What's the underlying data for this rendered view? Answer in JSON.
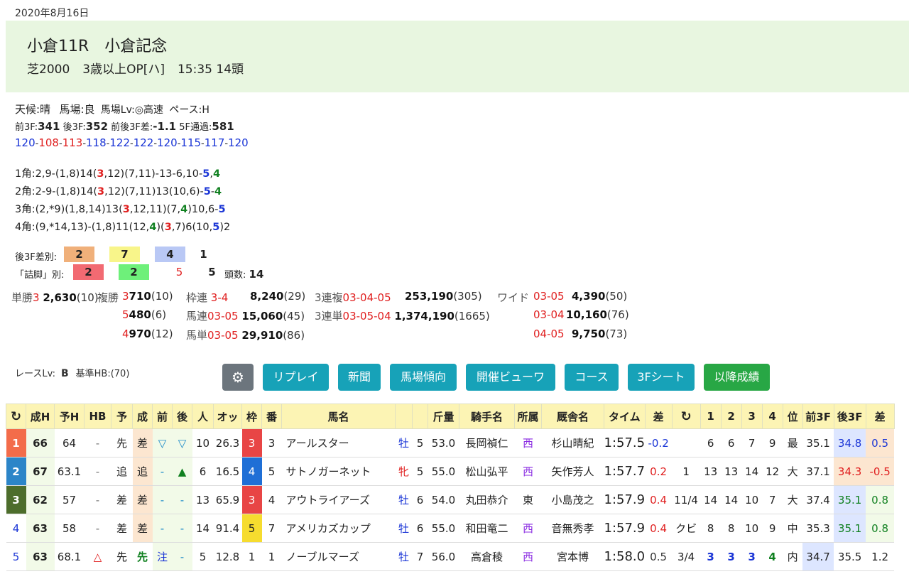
{
  "date": "2020年8月16日",
  "race": {
    "name1": "小倉11R",
    "name2": "小倉記念",
    "cond1": "芝2000",
    "cond2": "3歳以上OP[ハ]",
    "cond3": "15:35 14頭"
  },
  "conditions": {
    "weather": "天候:晴",
    "track": "馬場:良",
    "tracklv": "馬場Lv:◎高速",
    "pace": "ペース:H"
  },
  "f3": {
    "front_lbl": "前3F:",
    "front": "341",
    "back_lbl": "後3F:",
    "back": "352",
    "diff_lbl": "前後3F差:",
    "diff": "-1.1",
    "f5_lbl": "5F通過:",
    "f5": "581"
  },
  "laps": [
    "120",
    "108",
    "113",
    "118",
    "122",
    "122",
    "120",
    "115",
    "117",
    "120"
  ],
  "corners": {
    "c1": "1角:2,9-(1,8)14(<3>,12)(7,11)-13-6,10-[5],{4}",
    "c2": "2角:2-9-(1,8)14(<3>,12)(7,11)13(10,6)-[5]-{4}",
    "c3": "3角:(2,*9)(1,8,14)13(<3>,12,11)(7,{4})10,6-[5]",
    "c4": "4角:(9,*14,13)-(1,8)11(12,{4})(<3>,7)6(10,[5])2"
  },
  "diff3f": {
    "label": "後3F差別:",
    "v1": "2",
    "v2": "7",
    "v3": "4",
    "v4": "1"
  },
  "tsume": {
    "label": "「詰脚」別:",
    "v1": "2",
    "v2": "2",
    "v3": "5",
    "v4": "5",
    "count_lbl": "頭数:",
    "count": "14"
  },
  "payouts": {
    "tan_lbl": "単勝",
    "tan_num": "3",
    "tan_val": "2,630",
    "tan_pop": "(10)",
    "fuku_lbl": "複勝",
    "fuku": [
      {
        "n": "3",
        "v": "710",
        "p": "(10)"
      },
      {
        "n": "5",
        "v": "480",
        "p": "(6)"
      },
      {
        "n": "4",
        "v": "970",
        "p": "(12)"
      }
    ],
    "wakuren_lbl": "枠連",
    "wakuren_num": "3-4",
    "wakuren_val": "8,240",
    "wakuren_pop": "(29)",
    "umaren_lbl": "馬連",
    "umaren_num": "03-05",
    "umaren_val": "15,060",
    "umaren_pop": "(45)",
    "umatan_lbl": "馬単",
    "umatan_num": "03-05",
    "umatan_val": "29,910",
    "umatan_pop": "(86)",
    "sanpuku_lbl": "3連複",
    "sanpuku_num": "03-04-05",
    "sanpuku_val": "253,190",
    "sanpuku_pop": "(305)",
    "santan_lbl": "3連単",
    "santan_num": "03-05-04",
    "santan_val": "1,374,190",
    "santan_pop": "(1665)",
    "wide_lbl": "ワイド",
    "wide": [
      {
        "n": "03-05",
        "v": "4,390",
        "p": "(50)"
      },
      {
        "n": "03-04",
        "v": "10,160",
        "p": "(76)"
      },
      {
        "n": "04-05",
        "v": "9,750",
        "p": "(73)"
      }
    ]
  },
  "racelv": {
    "label": "レースLv:",
    "value": "B",
    "hb": "基準HB:(70)"
  },
  "buttons": {
    "settings": "⚙",
    "replay": "リプレイ",
    "news": "新聞",
    "trend": "馬場傾向",
    "viewer": "開催ビューワ",
    "course": "コース",
    "sheet": "3Fシート",
    "later": "以降成績"
  },
  "table": {
    "headers": [
      "↻",
      "成H",
      "予H",
      "HB",
      "予",
      "成",
      "前",
      "後",
      "人",
      "オッ",
      "枠",
      "番",
      "馬名",
      "",
      "",
      "斤量",
      "騎手名",
      "所属",
      "厩舎名",
      "タイム",
      "差",
      "↻",
      "1",
      "2",
      "3",
      "4",
      "位",
      "前3F",
      "後3F",
      "差"
    ],
    "rows": [
      [
        "1",
        "66",
        "64",
        "-",
        "先",
        "差",
        "▽",
        "▽",
        "10",
        "26.3",
        "3",
        "3",
        "アールスター",
        "牡",
        "5",
        "53.0",
        "長岡禎仁",
        "西",
        "杉山晴紀",
        "1:57.5",
        "-0.2",
        "",
        "6",
        "6",
        "7",
        "9",
        "最",
        "35.1",
        "34.8",
        "0.5"
      ],
      [
        "2",
        "67",
        "63.1",
        "-",
        "追",
        "追",
        "-",
        "▲",
        "6",
        "16.5",
        "4",
        "5",
        "サトノガーネット",
        "牝",
        "5",
        "55.0",
        "松山弘平",
        "西",
        "矢作芳人",
        "1:57.7",
        "0.2",
        "1",
        "13",
        "13",
        "14",
        "12",
        "大",
        "37.1",
        "34.3",
        "-0.5"
      ],
      [
        "3",
        "62",
        "57",
        "-",
        "差",
        "差",
        "-",
        "-",
        "13",
        "65.9",
        "3",
        "4",
        "アウトライアーズ",
        "牡",
        "6",
        "54.0",
        "丸田恭介",
        "東",
        "小島茂之",
        "1:57.9",
        "0.4",
        "11/4",
        "14",
        "14",
        "10",
        "7",
        "大",
        "37.4",
        "35.1",
        "0.8"
      ],
      [
        "4",
        "63",
        "58",
        "-",
        "差",
        "差",
        "-",
        "-",
        "14",
        "91.4",
        "5",
        "7",
        "アメリカズカップ",
        "牡",
        "6",
        "55.0",
        "和田竜二",
        "西",
        "音無秀孝",
        "1:57.9",
        "0.4",
        "クビ",
        "8",
        "8",
        "10",
        "9",
        "中",
        "35.3",
        "35.1",
        "0.8"
      ],
      [
        "5",
        "63",
        "68.1",
        "△",
        "先",
        "先",
        "注",
        "-",
        "5",
        "12.8",
        "1",
        "1",
        "ノーブルマーズ",
        "牡",
        "7",
        "56.0",
        "高倉稜",
        "西",
        "宮本博",
        "1:58.0",
        "0.5",
        "3/4",
        "3",
        "3",
        "3",
        "4",
        "内",
        "34.7",
        "35.5",
        "1.2"
      ]
    ]
  }
}
